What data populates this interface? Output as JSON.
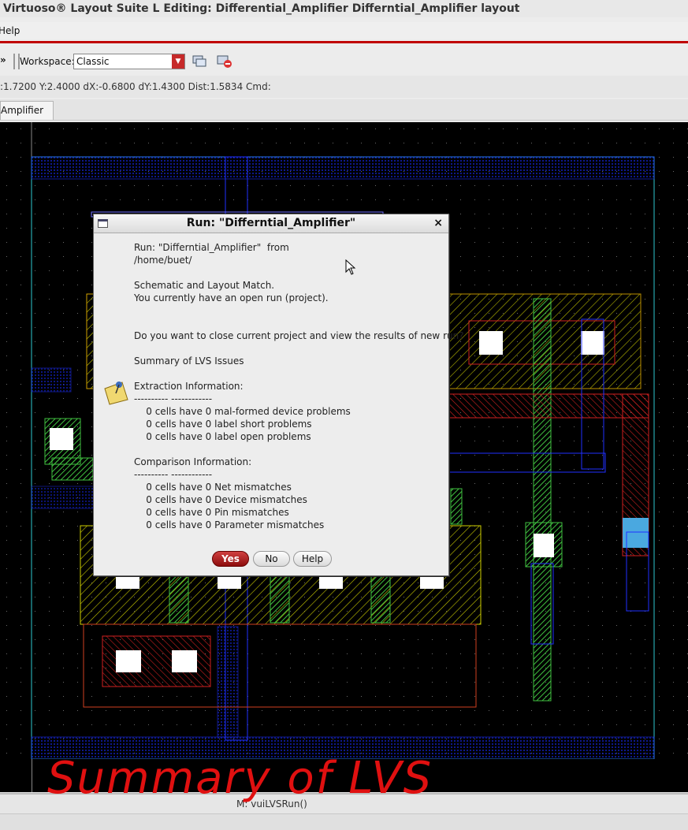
{
  "window": {
    "title": "Virtuoso® Layout Suite L Editing: Differential_Amplifier Differntial_Amplifier layout"
  },
  "menubar": {
    "help": "Help"
  },
  "toolbar": {
    "workspace_label": "Workspace:",
    "workspace_value": "Classic"
  },
  "coords": {
    "text": ":1.7200 Y:2.4000 dX:-0.6800 dY:1.4300 Dist:1.5834 Cmd:"
  },
  "tab": {
    "label": "Amplifier"
  },
  "dialog": {
    "title": "Run: \"Differntial_Amplifier\"",
    "close": "×",
    "lines": [
      "Run: \"Differntial_Amplifier\"  from",
      "/home/buet/",
      "",
      "Schematic and Layout Match.",
      "You currently have an open run (project).",
      "",
      "",
      "Do you want to close current project and view the results of new run?",
      "",
      "Summary of LVS Issues",
      "",
      "Extraction Information:",
      "---------- ------------",
      "    0 cells have 0 mal-formed device problems",
      "    0 cells have 0 label short problems",
      "    0 cells have 0 label open problems",
      "",
      "Comparison Information:",
      "---------- ------------",
      "    0 cells have 0 Net mismatches",
      "    0 cells have 0 Device mismatches",
      "    0 cells have 0 Pin mismatches",
      "    0 cells have 0 Parameter mismatches"
    ],
    "buttons": {
      "yes": "Yes",
      "no": "No",
      "help": "Help"
    }
  },
  "statusbar": {
    "text": "M: vuiLVSRun()"
  },
  "annotation": {
    "text": "Summary of LVS"
  },
  "colors": {
    "accent": "#c00000",
    "canvas": "#000000",
    "metal1": "#1a2cff",
    "poly": "#e02020",
    "active": "#39c23a"
  }
}
